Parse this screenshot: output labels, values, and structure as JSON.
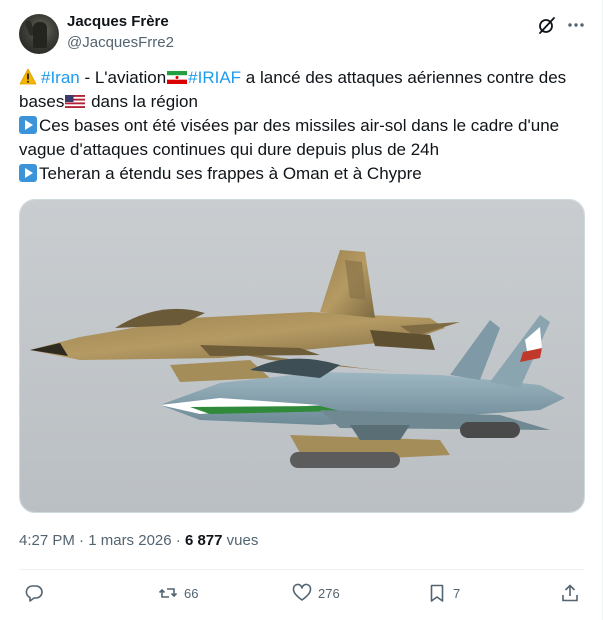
{
  "author": {
    "name": "Jacques Frère",
    "handle": "@JacquesFrre2"
  },
  "tweet": {
    "line1": {
      "tag1": "#Iran",
      "t1": " - L'aviation",
      "tag2": "#IRIAF",
      "t2": " a lancé des attaques aériennes contre des"
    },
    "line2": {
      "t1": "bases",
      "t2": " dans la région"
    },
    "line3": "Ces bases ont été visées par des missiles air-sol dans le cadre d'une",
    "line4": "vague d'attaques continues qui dure depuis plus de 24h",
    "line5": "Teheran a étendu ses frappes à Oman et à Chypre"
  },
  "meta": {
    "time": "4:27 PM",
    "sep1": " · ",
    "date": "1 mars 2026",
    "sep2": " · ",
    "views_count": "6 877",
    "views_label": " vues"
  },
  "actions": {
    "reply_count": "",
    "retweet_count": "66",
    "like_count": "276",
    "bookmark_count": "7"
  },
  "icons": [
    "warning-icon",
    "iran-flag-icon",
    "us-flag-icon",
    "play-button-icon",
    "grok-icon",
    "more-icon",
    "reply-icon",
    "retweet-icon",
    "like-icon",
    "bookmark-icon",
    "share-icon"
  ],
  "colors": {
    "hashtag": "#1d9bf0",
    "secondary_text": "#536471",
    "primary_text": "#0f1419"
  }
}
